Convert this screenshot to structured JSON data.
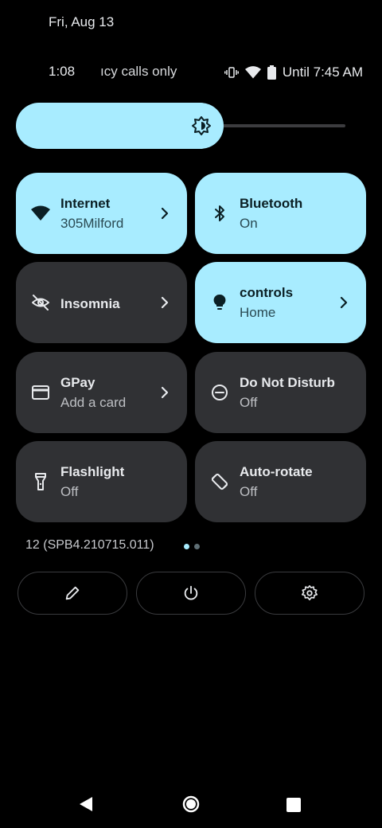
{
  "date": "Fri, Aug 13",
  "status": {
    "time": "1:08",
    "carrier": "ıcy calls only",
    "alarm": "Until 7:45 AM"
  },
  "brightness": {
    "level_percent": 63
  },
  "tiles": [
    {
      "id": "internet",
      "title": "Internet",
      "subtitle": "305Milford",
      "on": true,
      "icon": "wifi-icon",
      "chevron": true
    },
    {
      "id": "bluetooth",
      "title": "Bluetooth",
      "subtitle": "On",
      "on": true,
      "icon": "bluetooth-icon",
      "chevron": false
    },
    {
      "id": "insomnia",
      "title": "Insomnia",
      "subtitle": "",
      "on": false,
      "icon": "eye-off-icon",
      "chevron": true
    },
    {
      "id": "controls",
      "title": "controls",
      "subtitle": "Home",
      "on": true,
      "icon": "lightbulb-icon",
      "chevron": true
    },
    {
      "id": "gpay",
      "title": "GPay",
      "subtitle": "Add a card",
      "on": false,
      "icon": "card-icon",
      "chevron": true
    },
    {
      "id": "dnd",
      "title": "Do Not Disturb",
      "subtitle": "Off",
      "on": false,
      "icon": "minus-circle-icon",
      "chevron": false
    },
    {
      "id": "flashlight",
      "title": "Flashlight",
      "subtitle": "Off",
      "on": false,
      "icon": "flashlight-icon",
      "chevron": false
    },
    {
      "id": "autorotate",
      "title": "Auto-rotate",
      "subtitle": "Off",
      "on": false,
      "icon": "rotate-icon",
      "chevron": false
    }
  ],
  "build": "12 (SPB4.210715.011)",
  "pager": {
    "pages": 2,
    "active": 0
  },
  "actions": [
    "edit-icon",
    "power-icon",
    "settings-icon"
  ],
  "colors": {
    "tile_on": "#a8ecff",
    "tile_off": "#303134",
    "background": "#000000"
  }
}
